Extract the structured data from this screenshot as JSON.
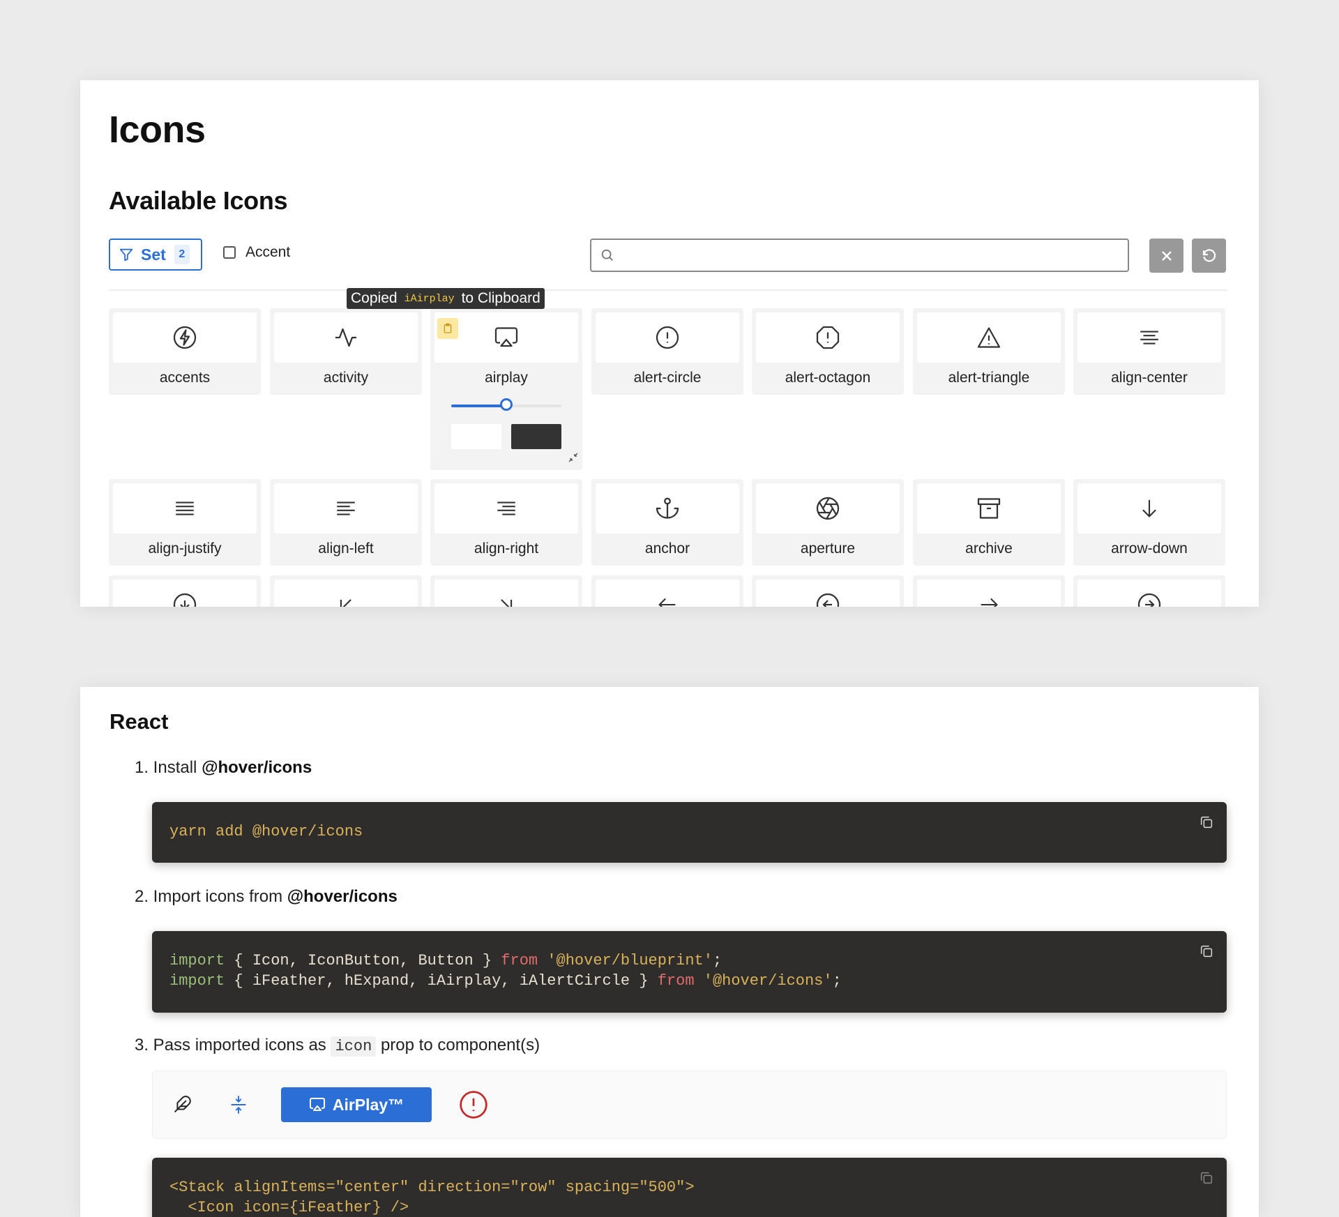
{
  "page": {
    "title": "Icons",
    "subtitle": "Available Icons"
  },
  "toolbar": {
    "set_label": "Set",
    "set_count": "2",
    "accent_label": "Accent",
    "search_placeholder": ""
  },
  "tooltip": {
    "prefix": "Copied",
    "code": "iAirplay",
    "suffix": "to Clipboard"
  },
  "icons": {
    "row1": [
      "accents",
      "activity",
      "airplay",
      "alert-circle",
      "alert-octagon",
      "alert-triangle",
      "align-center"
    ],
    "row2": [
      "align-justify",
      "align-left",
      "align-right",
      "anchor",
      "aperture",
      "archive",
      "arrow-down"
    ]
  },
  "airplay_slider_fraction": 0.5,
  "react": {
    "heading": "React",
    "step1_prefix": "1. Install",
    "step1_pkg": "@hover/icons",
    "code1": {
      "cmd": "yarn",
      "sub": "add",
      "pkg": "@hover/icons"
    },
    "step2_prefix": "2. Import icons from",
    "step2_pkg": "@hover/icons",
    "code2": {
      "line1": {
        "kw": "import",
        "names": "{ Icon, IconButton, Button }",
        "from": "from",
        "src": "'@hover/blueprint'",
        "end": ";"
      },
      "line2": {
        "kw": "import",
        "names": "{ iFeather, hExpand, iAirplay, iAlertCircle }",
        "from": "from",
        "src": "'@hover/icons'",
        "end": ";"
      }
    },
    "step3_prefix": "3. Pass imported icons as",
    "step3_code": "icon",
    "step3_suffix": "prop to component(s)",
    "airplay_button": "AirPlay™",
    "code3": {
      "line1": {
        "tag": "<Stack",
        "attrs": " alignItems=\"center\" direction=\"row\" spacing=\"500\">"
      },
      "line2": {
        "text": "  <Icon icon={iFeather} />"
      }
    }
  },
  "colors": {
    "accent": "#2b6fd6",
    "danger": "#c62828",
    "code_bg": "#2e2d2c"
  }
}
